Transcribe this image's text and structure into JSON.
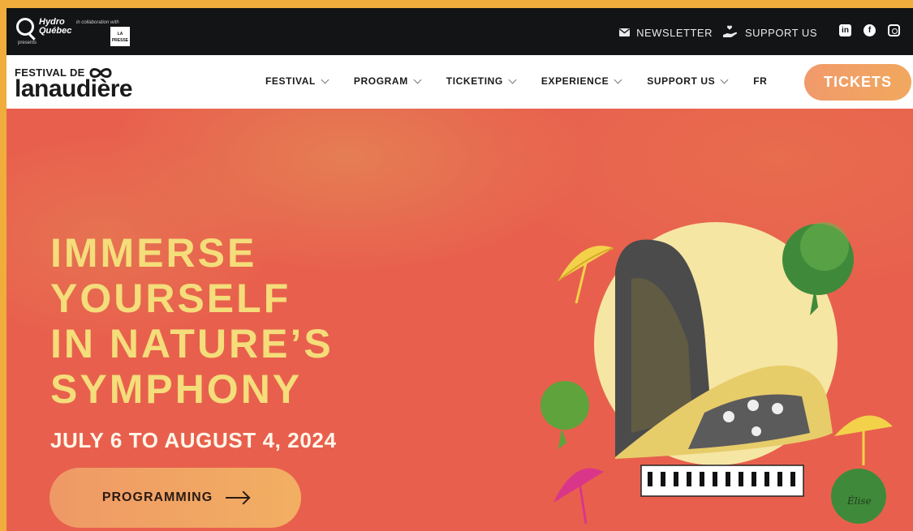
{
  "topbar": {
    "sponsor_name_line1": "Hydro",
    "sponsor_name_line2": "Québec",
    "sponsor_presents": "presents",
    "collab_text": "in collaboration with",
    "partner_logo_text": "LA PRESSE",
    "links": [
      {
        "label": "NEWSLETTER",
        "icon": "envelope-icon"
      },
      {
        "label": "SUPPORT US",
        "icon": "hand-heart-icon"
      }
    ],
    "socials": [
      {
        "name": "linkedin-icon",
        "glyph": "in"
      },
      {
        "name": "facebook-icon",
        "glyph": "f"
      },
      {
        "name": "instagram-icon",
        "glyph": ""
      }
    ]
  },
  "brand": {
    "top": "FESTIVAL DE",
    "main": "lanaudière"
  },
  "nav": {
    "items": [
      {
        "label": "FESTIVAL"
      },
      {
        "label": "PROGRAM"
      },
      {
        "label": "TICKETING"
      },
      {
        "label": "EXPERIENCE"
      },
      {
        "label": "SUPPORT US"
      }
    ],
    "lang": "FR",
    "tickets_label": "TICKETS"
  },
  "hero": {
    "headline": [
      "IMMERSE",
      "YOURSELF",
      "IN NATURE’S",
      "SYMPHONY"
    ],
    "dates": "JULY 6 TO AUGUST 4, 2024",
    "cta_label": "PROGRAMMING",
    "signature": "Élise"
  },
  "colors": {
    "accent": "#f1a85e",
    "hero_bg": "#e8604d",
    "headline": "#f4dd7a",
    "topbar": "#121416",
    "page_border": "#f0ad3c"
  }
}
